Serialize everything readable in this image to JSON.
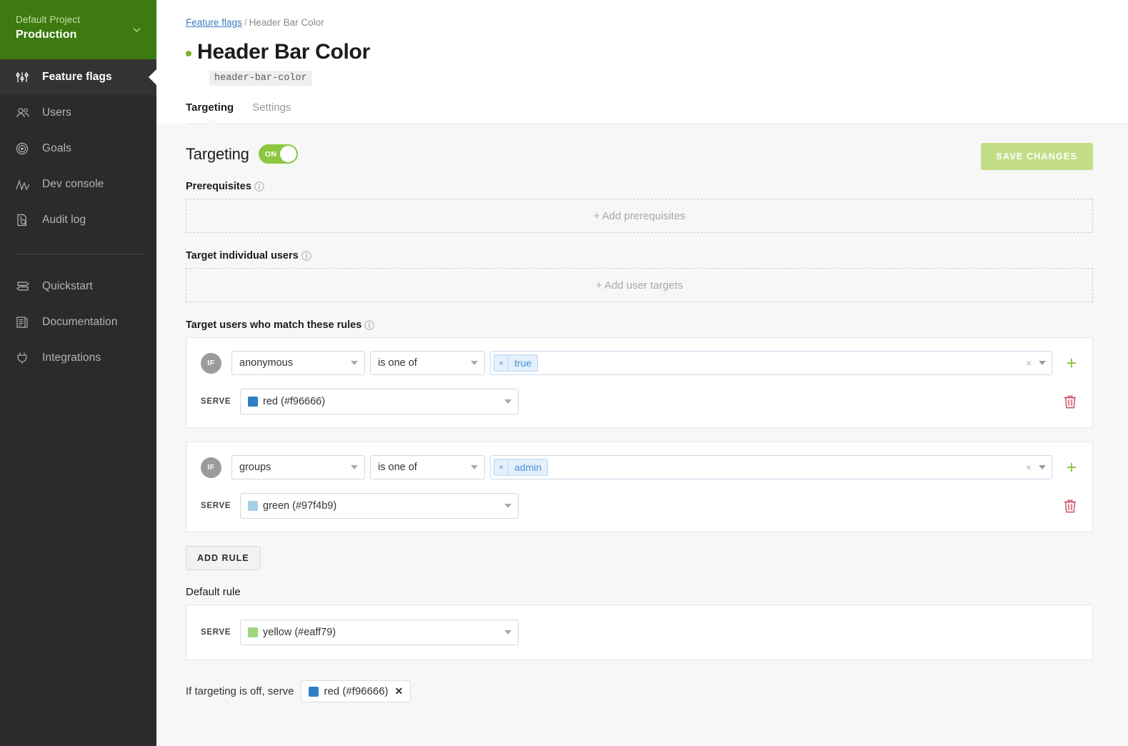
{
  "sidebar": {
    "project": {
      "name": "Default Project",
      "environment": "Production"
    },
    "items": [
      {
        "label": "Feature flags",
        "icon": "sliders-icon",
        "active": true
      },
      {
        "label": "Users",
        "icon": "users-icon",
        "active": false
      },
      {
        "label": "Goals",
        "icon": "target-icon",
        "active": false
      },
      {
        "label": "Dev console",
        "icon": "chart-icon",
        "active": false
      },
      {
        "label": "Audit log",
        "icon": "audit-log-icon",
        "active": false
      }
    ],
    "secondary_items": [
      {
        "label": "Quickstart",
        "icon": "signpost-icon"
      },
      {
        "label": "Documentation",
        "icon": "document-icon"
      },
      {
        "label": "Integrations",
        "icon": "plug-icon"
      }
    ]
  },
  "breadcrumb": {
    "parent": "Feature flags",
    "separator": "/",
    "current": "Header Bar Color"
  },
  "flag": {
    "title": "Header Bar Color",
    "key": "header-bar-color",
    "status_color": "#7bb026"
  },
  "tabs": [
    {
      "label": "Targeting",
      "active": true
    },
    {
      "label": "Settings",
      "active": false
    }
  ],
  "targeting": {
    "heading": "Targeting",
    "toggle_state": "ON",
    "toggle_color": "#8cc63f",
    "save_button": "SAVE CHANGES",
    "save_button_color": "#c3dd87"
  },
  "prerequisites": {
    "label": "Prerequisites",
    "add_text": "+ Add prerequisites"
  },
  "individual_users": {
    "label": "Target individual users",
    "add_text": "+ Add user targets"
  },
  "rules_section": {
    "label": "Target users who match these rules",
    "add_rule_button": "ADD RULE"
  },
  "rules": [
    {
      "if_badge": "IF",
      "attribute": "anonymous",
      "operator": "is one of",
      "values": [
        "true"
      ],
      "serve_label": "SERVE",
      "serve_value": "red (#f96666)",
      "serve_swatch": "#2f7fc4"
    },
    {
      "if_badge": "IF",
      "attribute": "groups",
      "operator": "is one of",
      "values": [
        "admin"
      ],
      "serve_label": "SERVE",
      "serve_value": "green (#97f4b9)",
      "serve_swatch": "#a8cfe8"
    }
  ],
  "default_rule": {
    "label": "Default rule",
    "serve_label": "SERVE",
    "serve_value": "yellow (#eaff79)",
    "serve_swatch": "#9fd67f"
  },
  "off_variation": {
    "text": "If targeting is off, serve",
    "value": "red (#f96666)",
    "swatch": "#2f7fc4",
    "remove": "✕"
  }
}
